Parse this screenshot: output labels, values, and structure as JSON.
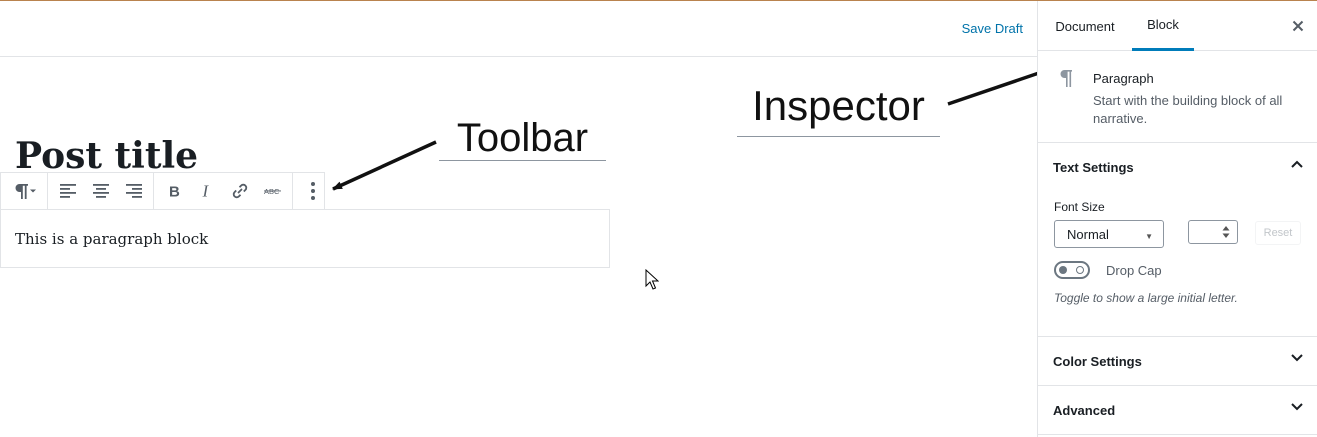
{
  "header": {
    "save_draft_label": "Save Draft"
  },
  "post": {
    "title": "Post title"
  },
  "paragraph": {
    "text": "This is a paragraph block"
  },
  "annotations": {
    "toolbar_label": "Toolbar",
    "inspector_label": "Inspector"
  },
  "toolbar": {
    "buttons": [
      "paragraph-icon",
      "align-left-icon",
      "align-center-icon",
      "align-right-icon",
      "bold-icon",
      "italic-icon",
      "link-icon",
      "strikethrough-icon",
      "more-options-icon"
    ]
  },
  "sidebar": {
    "tabs": [
      {
        "label": "Document",
        "active": false
      },
      {
        "label": "Block",
        "active": true
      }
    ],
    "block_card": {
      "title": "Paragraph",
      "description": "Start with the building block of all narrative."
    },
    "text_settings": {
      "title": "Text Settings",
      "font_size_label": "Font Size",
      "font_size_value": "Normal",
      "reset_label": "Reset",
      "drop_cap_label": "Drop Cap",
      "help_text": "Toggle to show a large initial letter.",
      "expanded": true
    },
    "color_settings": {
      "title": "Color Settings",
      "expanded": false
    },
    "advanced": {
      "title": "Advanced",
      "expanded": false
    }
  },
  "colors": {
    "accent": "#007cba",
    "link": "#0073aa",
    "top_border": "#b9834e"
  }
}
